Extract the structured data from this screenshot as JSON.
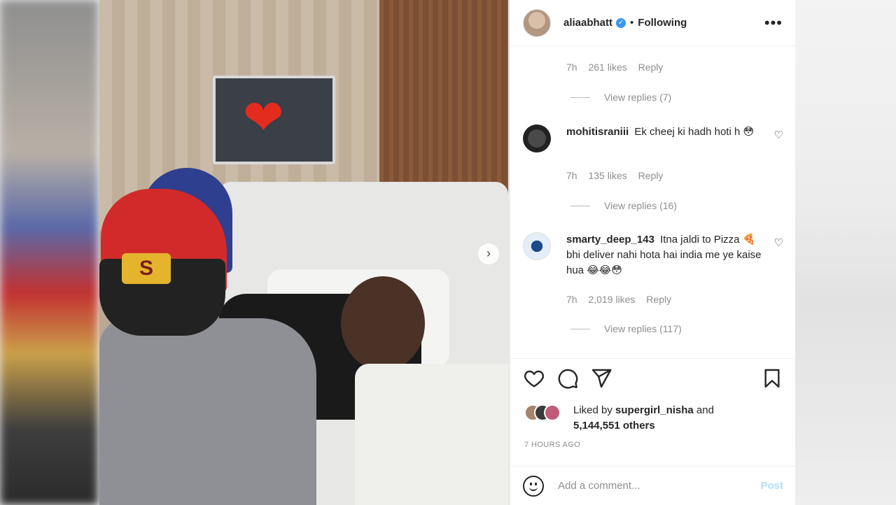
{
  "post": {
    "username": "aliaabhatt",
    "follow_state": "Following",
    "separator": "•",
    "more_icon": "more-horizontal-icon",
    "verified_icon": "verified-badge-icon"
  },
  "photo": {
    "overlay_heart": "❤",
    "cap_logo": "S",
    "next_icon": "chevron-right-icon",
    "next_glyph": "›"
  },
  "comments": [
    {
      "meta": {
        "time": "7h",
        "likes": "261 likes",
        "reply": "Reply"
      },
      "view_replies": "View replies (7)"
    },
    {
      "username": "mohitisraniii",
      "text": "Ek cheej ki hadh hoti h",
      "emojis": "😳",
      "meta": {
        "time": "7h",
        "likes": "135 likes",
        "reply": "Reply"
      },
      "view_replies": "View replies (16)"
    },
    {
      "username": "smarty_deep_143",
      "text": "Itna jaldi to Pizza 🍕 bhi deliver nahi hota hai india me ye kaise hua",
      "emojis": "😂😂😳",
      "meta": {
        "time": "7h",
        "likes": "2,019 likes",
        "reply": "Reply"
      },
      "view_replies": "View replies (117)"
    }
  ],
  "actions": {
    "like_icon": "heart-outline-icon",
    "comment_icon": "comment-bubble-icon",
    "share_icon": "send-paper-plane-icon",
    "save_icon": "bookmark-icon"
  },
  "likes": {
    "prefix": "Liked by",
    "liked_user": "supergirl_nisha",
    "and": "and",
    "others": "5,144,551 others"
  },
  "time_ago": "7 HOURS AGO",
  "add_comment": {
    "placeholder": "Add a comment...",
    "post_label": "Post",
    "emoji_icon": "emoji-smile-icon"
  },
  "colors": {
    "accent": "#3897f0",
    "post_disabled": "#b2dffc",
    "text": "#262626",
    "secondary": "#8e8e8e"
  }
}
